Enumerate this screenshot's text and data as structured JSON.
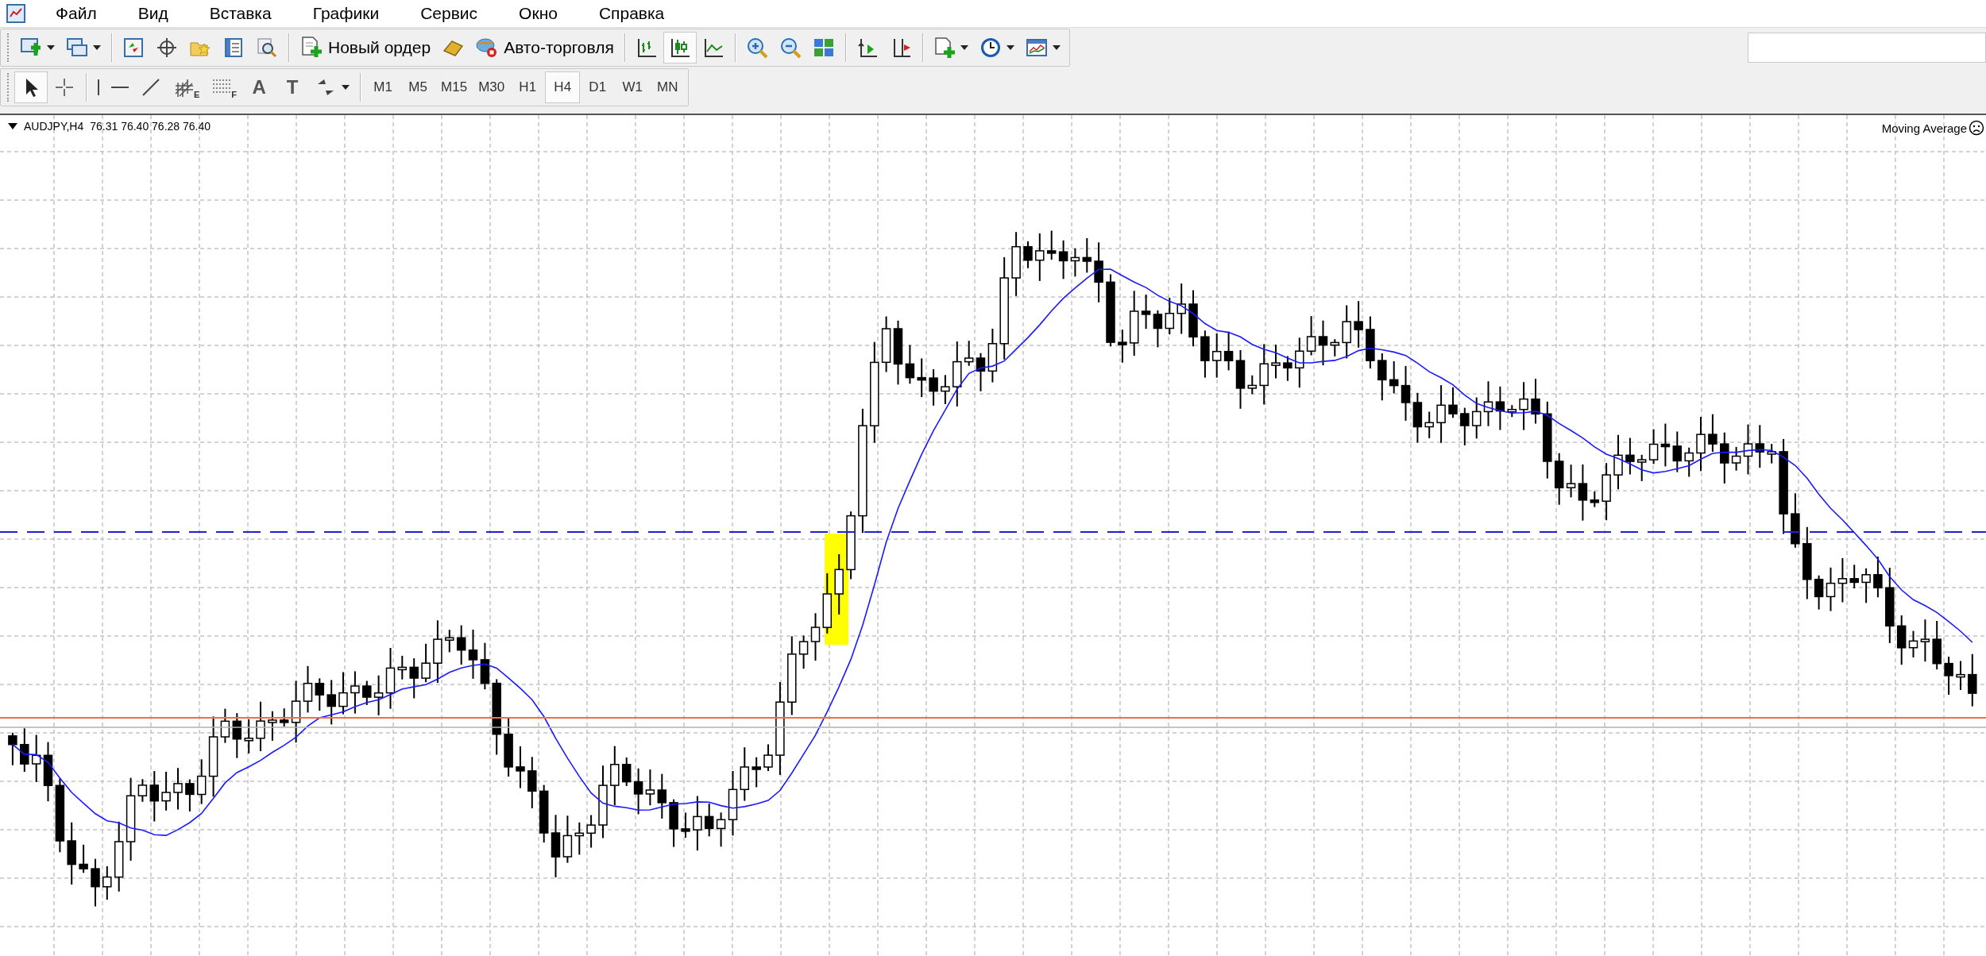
{
  "menu": [
    "Файл",
    "Вид",
    "Вставка",
    "Графики",
    "Сервис",
    "Окно",
    "Справка"
  ],
  "toolbar": {
    "new_order": "Новый ордер",
    "auto_trading": "Авто-торговля",
    "chart_types": [
      {
        "kind": "bars",
        "selected": false
      },
      {
        "kind": "candles",
        "selected": true
      },
      {
        "kind": "line",
        "selected": false
      }
    ]
  },
  "drawing_tools": [
    {
      "kind": "cursor",
      "selected": true
    },
    {
      "kind": "crosshair",
      "selected": false
    },
    {
      "kind": "vline",
      "selected": false
    },
    {
      "kind": "hline",
      "selected": false
    },
    {
      "kind": "trendline",
      "selected": false
    },
    {
      "kind": "channel",
      "selected": false,
      "mark": "E"
    },
    {
      "kind": "fibo",
      "selected": false,
      "mark": "F"
    },
    {
      "kind": "text",
      "selected": false,
      "glyph": "A"
    },
    {
      "kind": "label",
      "selected": false,
      "glyph": "T"
    },
    {
      "kind": "arrows",
      "selected": false
    }
  ],
  "timeframes": [
    {
      "label": "M1",
      "selected": false
    },
    {
      "label": "M5",
      "selected": false
    },
    {
      "label": "M15",
      "selected": false
    },
    {
      "label": "M30",
      "selected": false
    },
    {
      "label": "H1",
      "selected": false
    },
    {
      "label": "H4",
      "selected": true
    },
    {
      "label": "D1",
      "selected": false
    },
    {
      "label": "W1",
      "selected": false
    },
    {
      "label": "MN",
      "selected": false
    }
  ],
  "chart": {
    "symbol": "AUDJPY,H4",
    "quotes": "76.31 76.40 76.28 76.40",
    "expert": "Moving Average"
  }
}
